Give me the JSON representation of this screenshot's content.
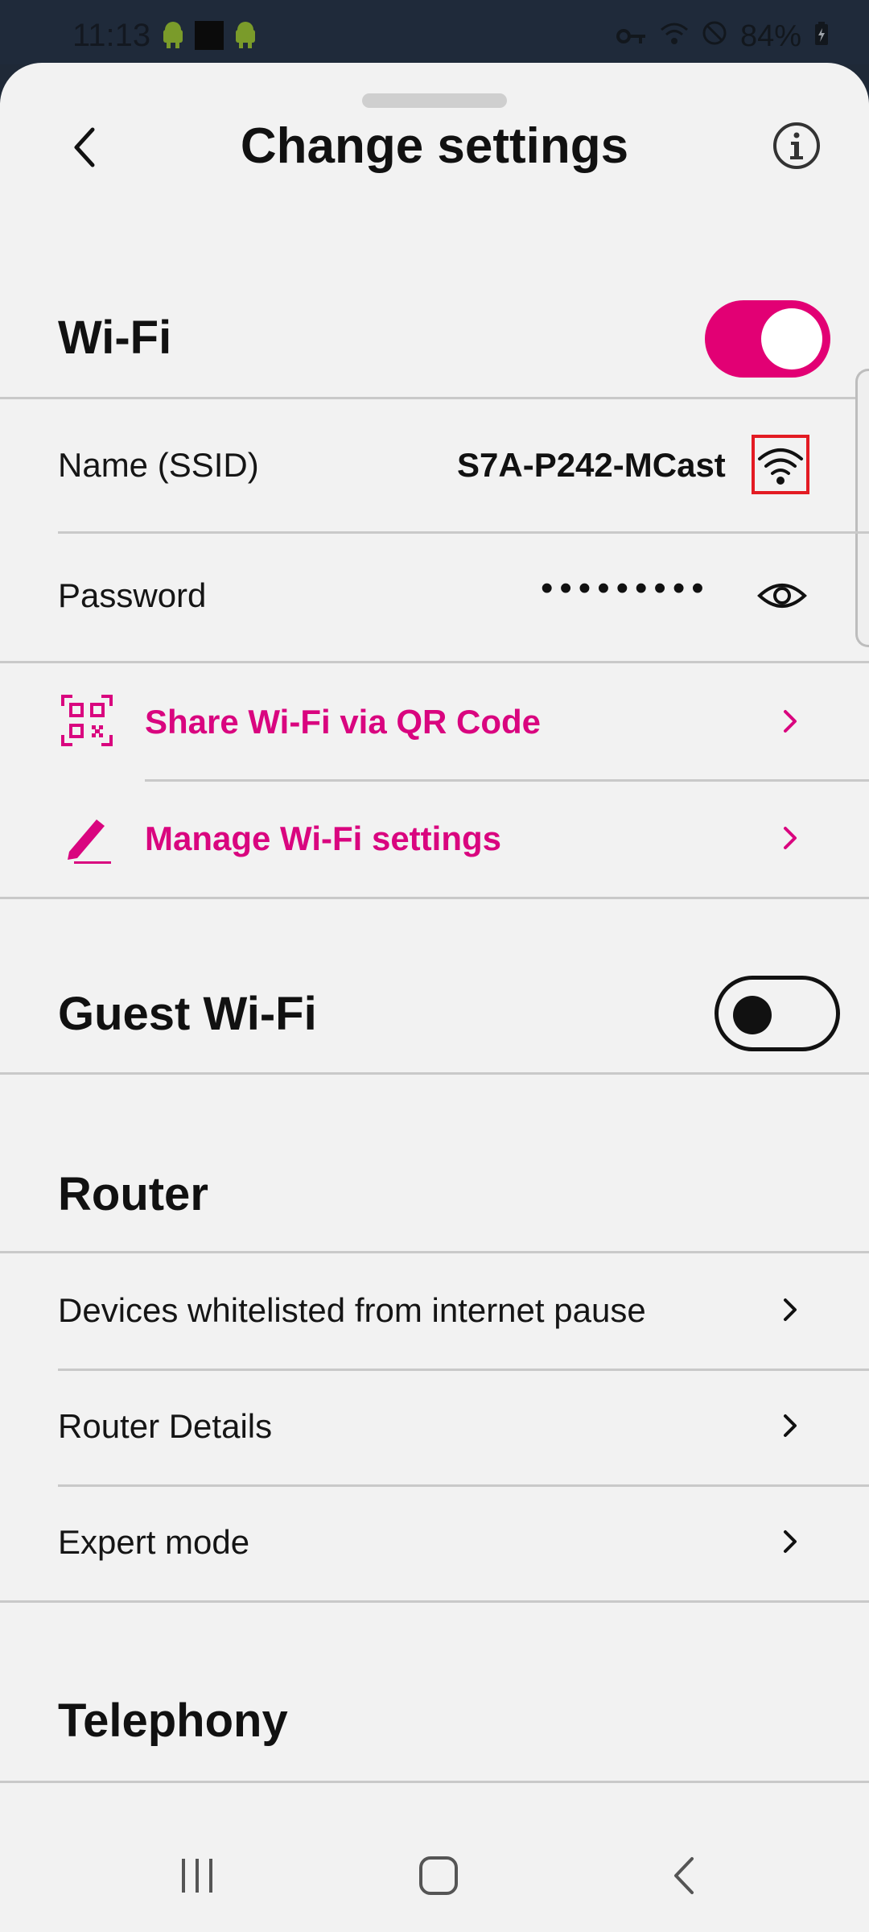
{
  "status_bar": {
    "time": "11:13",
    "battery": "84%"
  },
  "header": {
    "title": "Change settings"
  },
  "wifi_section": {
    "title": "Wi-Fi",
    "toggle_on": true,
    "ssid_label": "Name (SSID)",
    "ssid_value": "S7A-P242-MCast",
    "password_label": "Password",
    "password_mask": "•••••••••",
    "share_label": "Share Wi-Fi via QR Code",
    "manage_label": "Manage Wi-Fi settings"
  },
  "guest_section": {
    "title": "Guest Wi-Fi",
    "toggle_on": false
  },
  "router_section": {
    "title": "Router",
    "items": [
      {
        "label": "Devices whitelisted from internet pause"
      },
      {
        "label": "Router Details"
      },
      {
        "label": "Expert mode"
      }
    ]
  },
  "telephony_section": {
    "title": "Telephony"
  },
  "colors": {
    "accent": "#e20074",
    "accent_text": "#d9057f",
    "background": "#f2f2f2",
    "status_bar": "#1f2a3a"
  },
  "icons": {
    "back": "chevron-left-icon",
    "info": "info-icon",
    "wifi": "wifi-icon",
    "eye": "eye-icon",
    "qr": "qr-code-icon",
    "pen": "pen-icon"
  }
}
